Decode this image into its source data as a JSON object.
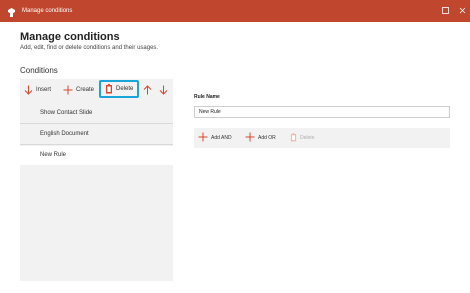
{
  "window": {
    "title": "Manage conditions",
    "app_icon": "powerpoint-addin-icon",
    "maximize_icon": "maximize-icon",
    "close_icon": "close-icon"
  },
  "header": {
    "title": "Manage conditions",
    "subtitle": "Add, edit, find or delete conditions and their usages."
  },
  "conditions": {
    "section_label": "Conditions",
    "toolbar": {
      "insert_label": "Insert",
      "create_label": "Create",
      "delete_label": "Delete"
    },
    "items": [
      {
        "label": "Show Contact Slide"
      },
      {
        "label": "English Document"
      },
      {
        "label": "New Rule"
      }
    ],
    "selected_index": 2
  },
  "rule": {
    "name_label": "Rule Name",
    "name_value": "New Rule",
    "toolbar": {
      "add_and_label": "Add AND",
      "add_or_label": "Add OR",
      "delete_label": "Delete"
    }
  },
  "colors": {
    "titlebar": "#c0472e",
    "accent_red": "#d9452b",
    "highlight_border": "#1aa5d8",
    "panel_bg": "#f2f2f2"
  }
}
